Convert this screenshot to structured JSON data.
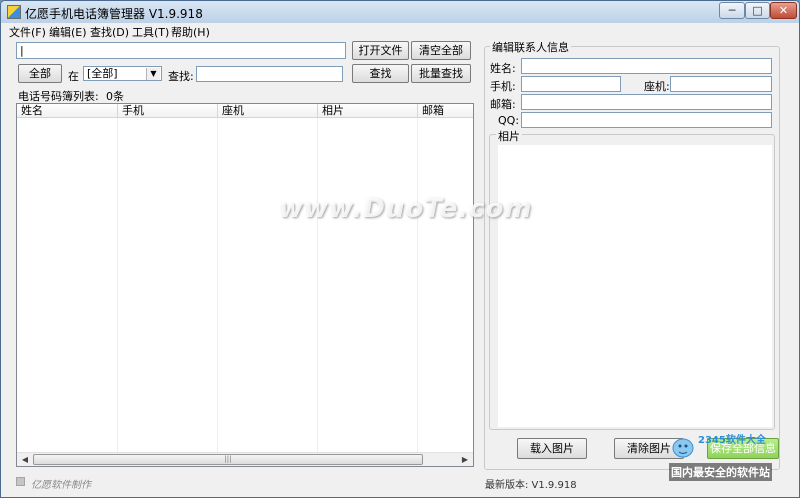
{
  "window": {
    "title": "亿愿手机电话簿管理器 V1.9.918",
    "minimize_glyph": "─",
    "maximize_glyph": "□",
    "close_glyph": "✕"
  },
  "menu": [
    {
      "label": "文件(F)"
    },
    {
      "label": "编辑(E)"
    },
    {
      "label": "查找(D)"
    },
    {
      "label": "工具(T)"
    },
    {
      "label": "帮助(H)"
    }
  ],
  "toolbar": {
    "top_input_value": "|",
    "open_file_label": "打开文件",
    "clear_all_label": "清空全部",
    "all_button_label": "全部",
    "in_label": "在",
    "scope_select_value": "[全部]",
    "find_label": "查找:",
    "find_input_value": "",
    "search_button_label": "查找",
    "batch_search_label": "批量查找"
  },
  "phonebook": {
    "list_title": "电话号码簿列表:",
    "count_text": "0条",
    "columns": [
      "姓名",
      "手机",
      "座机",
      "相片",
      "邮箱"
    ]
  },
  "contact_panel": {
    "group_title": "编辑联系人信息",
    "name_label": "姓名:",
    "mobile_label": "手机:",
    "landline_label": "座机:",
    "email_label": "邮箱:",
    "qq_label": "QQ:",
    "name_value": "",
    "mobile_value": "",
    "landline_value": "",
    "email_value": "",
    "qq_value": "",
    "photo_title": "相片",
    "load_photo_label": "载入图片",
    "clear_photo_label": "清除图片",
    "save_all_label": "保存全部信息"
  },
  "status": {
    "author_text": "亿愿软件制作",
    "latest_version_text": "最新版本: V1.9.918"
  },
  "overlay": {
    "watermark_text": "www.DuoTe.com",
    "corner_logo_text": "2345软件大全",
    "corner_slogan_text": "国内最安全的软件站"
  },
  "colors": {
    "title_bar": "#bcd1e7",
    "close_button": "#c24b35",
    "save_button": "#8fd35a"
  }
}
